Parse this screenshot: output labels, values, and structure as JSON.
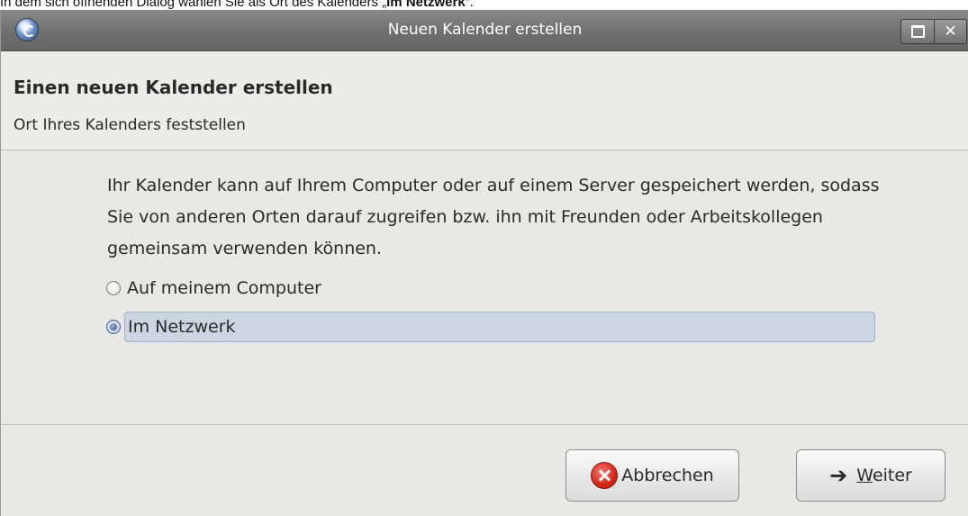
{
  "caption": {
    "prefix": "In dem sich öffnenden Dialog wählen Sie als Ort des Kalenders „",
    "bold": "Im Netzwerk",
    "suffix": "“."
  },
  "window": {
    "title": "Neuen Kalender erstellen",
    "icon": "thunderbird-icon"
  },
  "header": {
    "title": "Einen neuen Kalender erstellen",
    "subtitle": "Ort Ihres Kalenders feststellen"
  },
  "body": {
    "description": "Ihr Kalender kann auf Ihrem Computer oder auf einem Server gespeichert werden, sodass Sie von anderen Orten darauf zugreifen bzw. ihn mit Freunden oder Arbeitskollegen gemeinsam verwenden können.",
    "options": [
      {
        "label": "Auf meinem Computer",
        "checked": false
      },
      {
        "label": "Im Netzwerk",
        "checked": true
      }
    ]
  },
  "buttons": {
    "cancel": {
      "label": "Abbrechen",
      "icon": "cancel-icon"
    },
    "next": {
      "mnemonic": "W",
      "rest": "eiter",
      "icon": "arrow-right-icon"
    }
  }
}
